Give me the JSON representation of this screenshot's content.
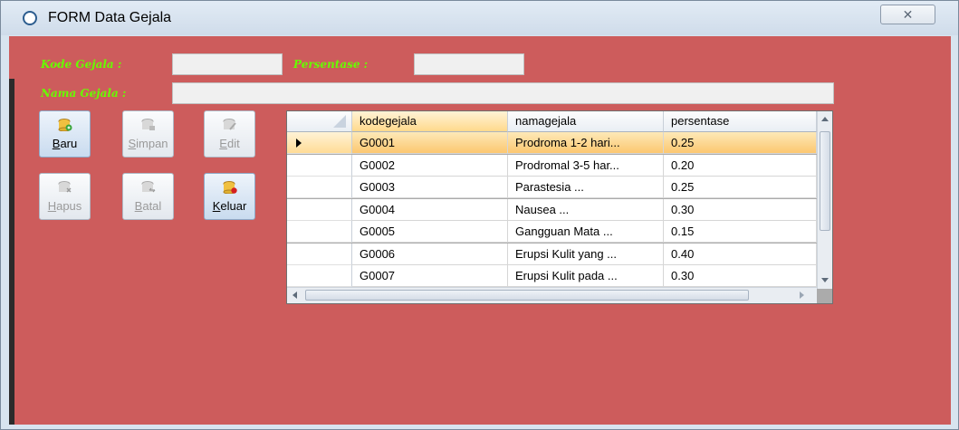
{
  "window": {
    "title": "FORM Data Gejala",
    "close_glyph": "✕",
    "form_background": "#cd5c5c"
  },
  "form": {
    "kode_label": "Kode Gejala :",
    "kode_value": "",
    "persentase_label": "Persentase :",
    "persentase_value": "",
    "nama_label": "Nama Gejala :",
    "nama_value": "",
    "label_color": "#66ff00"
  },
  "toolbar": {
    "baru": {
      "label": "Baru",
      "underline": "B",
      "rest": "aru",
      "icon": "db-add-icon",
      "enabled": true
    },
    "simpan": {
      "label": "Simpan",
      "underline": "S",
      "rest": "impan",
      "icon": "db-save-icon",
      "enabled": false
    },
    "edit": {
      "label": "Edit",
      "underline": "E",
      "rest": "dit",
      "icon": "db-edit-icon",
      "enabled": false
    },
    "hapus": {
      "label": "Hapus",
      "underline": "H",
      "rest": "apus",
      "icon": "db-delete-icon",
      "enabled": false
    },
    "batal": {
      "label": "Batal",
      "underline": "B",
      "rest": "atal",
      "icon": "db-undo-icon",
      "enabled": false
    },
    "keluar": {
      "label": "Keluar",
      "underline": "K",
      "rest": "eluar",
      "icon": "db-exit-icon",
      "enabled": true
    }
  },
  "grid": {
    "columns": [
      "kodegejala",
      "namagejala",
      "persentase"
    ],
    "rows": [
      {
        "kodegejala": "G0001",
        "namagejala": "Prodroma 1-2 hari...",
        "persentase": "0.25",
        "selected": true
      },
      {
        "kodegejala": "G0002",
        "namagejala": "Prodromal 3-5 har...",
        "persentase": "0.20",
        "selected": false
      },
      {
        "kodegejala": "G0003",
        "namagejala": "Parastesia        ...",
        "persentase": "0.25",
        "selected": false
      },
      {
        "kodegejala": "G0004",
        "namagejala": "Nausea             ...",
        "persentase": "0.30",
        "selected": false
      },
      {
        "kodegejala": "G0005",
        "namagejala": "Gangguan Mata   ...",
        "persentase": "0.15",
        "selected": false
      },
      {
        "kodegejala": "G0006",
        "namagejala": "Erupsi Kulit yang ...",
        "persentase": "0.40",
        "selected": false
      },
      {
        "kodegejala": "G0007",
        "namagejala": "Erupsi Kulit pada ...",
        "persentase": "0.30",
        "selected": false
      }
    ]
  }
}
